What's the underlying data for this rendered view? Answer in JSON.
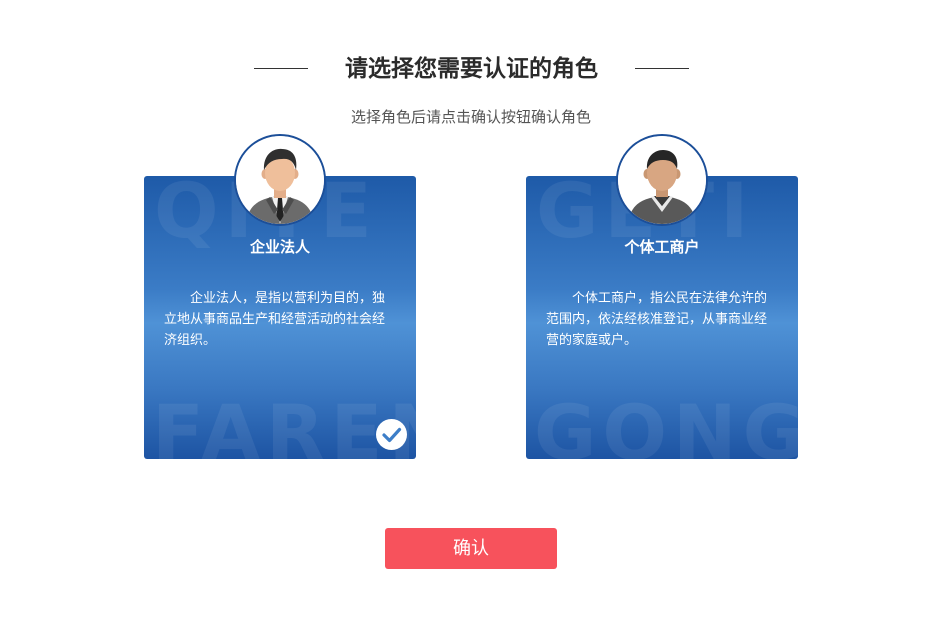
{
  "header": {
    "title": "请选择您需要认证的角色",
    "subtitle": "选择角色后请点击确认按钮确认角色"
  },
  "roles": [
    {
      "name": "企业法人",
      "description": "企业法人，是指以营利为目的，独立地从事商品生产和经营活动的社会经济组织。",
      "watermark_top": "QIYE",
      "watermark_bottom": "FAREN",
      "selected": true,
      "icon": "businessman-avatar-icon"
    },
    {
      "name": "个体工商户",
      "description": "个体工商户，指公民在法律允许的范围内，依法经核准登记，从事商业经营的家庭或户。",
      "watermark_top": "GETI",
      "watermark_bottom": "GONGSHANG",
      "selected": false,
      "icon": "individual-avatar-icon"
    }
  ],
  "actions": {
    "confirm_label": "确认"
  },
  "colors": {
    "card_blue": "#3b7cc6",
    "avatar_border": "#1c4f99",
    "confirm_button": "#f7525c",
    "title_text": "#2b2b2b"
  }
}
